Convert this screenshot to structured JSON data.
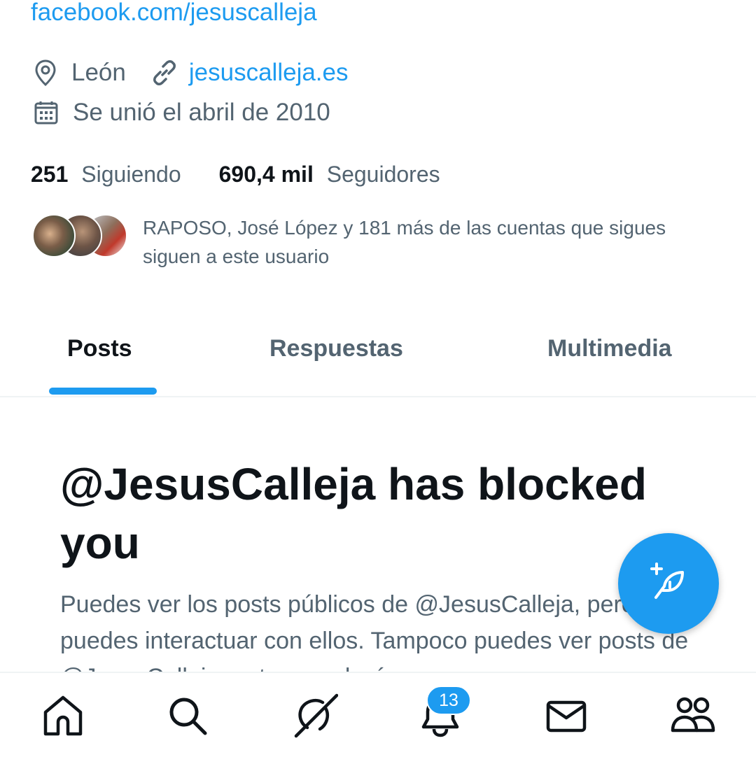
{
  "profile": {
    "facebook_link": "facebook.com/jesuscalleja",
    "location": "León",
    "website": "jesuscalleja.es",
    "joined": "Se unió el abril de 2010",
    "following_count": "251",
    "following_label": "Siguiendo",
    "followers_count": "690,4 mil",
    "followers_label": "Seguidores",
    "followers_you_know": "RAPOSO, José López y 181 más de las cuentas que sigues siguen a este usuario"
  },
  "tabs": [
    {
      "label": "Posts",
      "selected": true
    },
    {
      "label": "Respuestas",
      "selected": false
    },
    {
      "label": "Multimedia",
      "selected": false
    }
  ],
  "blocked": {
    "title": "@JesusCalleja has blocked you",
    "body": "Puedes ver los posts públicos de @JesusCalleja, pero no puedes interactuar con ellos. Tampoco puedes ver posts de @JesusCalleja en tu cronología."
  },
  "fab": {
    "icon": "compose-post-icon"
  },
  "bottom_nav": {
    "items": [
      {
        "icon": "home-icon"
      },
      {
        "icon": "search-icon"
      },
      {
        "icon": "grok-icon"
      },
      {
        "icon": "notifications-icon"
      },
      {
        "icon": "messages-icon"
      },
      {
        "icon": "communities-icon"
      }
    ],
    "notification_badge": "13"
  },
  "colors": {
    "accent": "#1d9bf0",
    "text_primary": "#0f1419",
    "text_secondary": "#536471",
    "divider": "#eff3f4"
  }
}
